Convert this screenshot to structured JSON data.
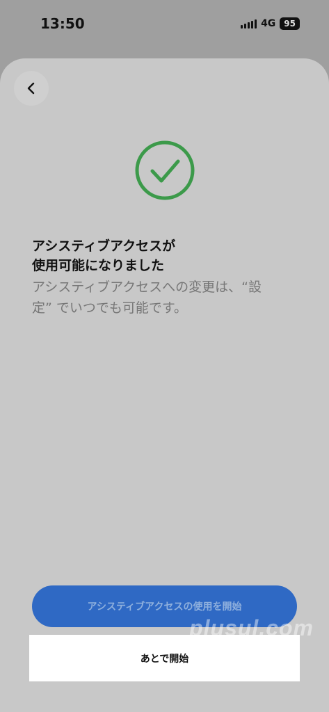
{
  "status_bar": {
    "time": "13:50",
    "network": "4G",
    "battery": "95"
  },
  "header": {
    "back_icon": "chevron-left-icon"
  },
  "content": {
    "success_icon": "check-circle-icon",
    "success_color": "#3c9a4a",
    "title_line1": "アシスティブアクセスが",
    "title_line2": "使用可能になりました",
    "description_line1": "アシスティブアクセスへの変更は、“設",
    "description_line2": "定” でいつでも可能です。"
  },
  "actions": {
    "primary_label": "アシスティブアクセスの使用を開始",
    "secondary_label": "あとで開始",
    "primary_color": "#2f69c4"
  },
  "watermark": {
    "text": "plusul.com"
  }
}
